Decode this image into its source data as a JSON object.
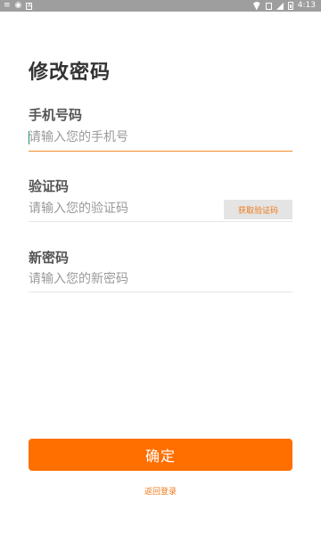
{
  "status_bar": {
    "left_icons": [
      "menu-icon",
      "android-debug-icon",
      "app-notification-icon"
    ],
    "right_icons": [
      "wifi-icon",
      "sim-icon",
      "signal-icon",
      "battery-icon"
    ],
    "time": "4:13"
  },
  "page": {
    "title": "修改密码"
  },
  "form": {
    "phone": {
      "label": "手机号码",
      "placeholder": "请输入您的手机号",
      "value": ""
    },
    "code": {
      "label": "验证码",
      "placeholder": "请输入您的验证码",
      "value": "",
      "get_code_label": "获取验证码"
    },
    "new_password": {
      "label": "新密码",
      "placeholder": "请输入您的新密码",
      "value": ""
    }
  },
  "actions": {
    "confirm_label": "确定",
    "back_login_label": "返回登录"
  },
  "colors": {
    "accent": "#ff6f00",
    "status_bar": "#9e9e9e",
    "active_underline": "#f08a2a"
  }
}
